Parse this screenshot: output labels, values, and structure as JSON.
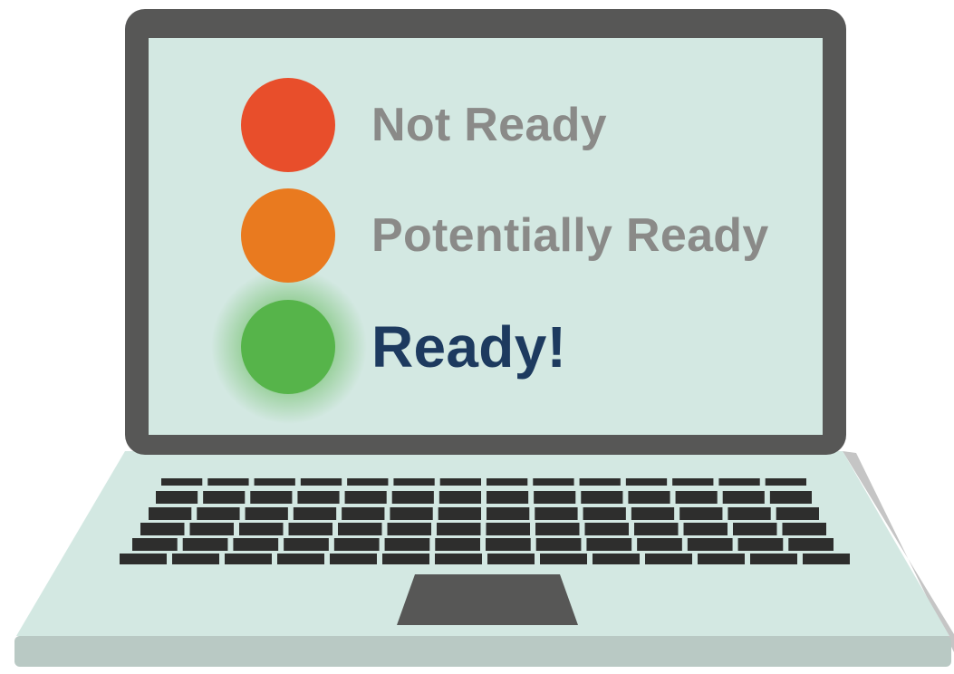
{
  "colors": {
    "bezel": "#575756",
    "screen": "#d3e8e2",
    "deck": "#d3e8e2",
    "deck_edge": "#b9c9c4",
    "keys": "#2e2e2d",
    "touchpad": "#575756",
    "muted_text": "#8a8a88",
    "ready_text": "#1d3a5f"
  },
  "statuses": [
    {
      "label": "Not Ready",
      "color": "#e84e2b",
      "text_color": "#8a8a88",
      "glow": false,
      "icon": "red-status-light-icon"
    },
    {
      "label": "Potentially Ready",
      "color": "#e97a1f",
      "text_color": "#8a8a88",
      "glow": false,
      "icon": "orange-status-light-icon"
    },
    {
      "label": "Ready!",
      "color": "#56b44a",
      "text_color": "#1d3a5f",
      "glow": true,
      "icon": "green-status-light-icon"
    }
  ]
}
